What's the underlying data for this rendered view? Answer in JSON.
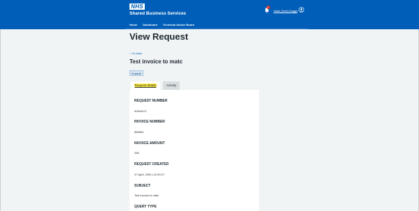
{
  "header": {
    "logo": "NHS",
    "service_name": "Shared Business Services",
    "notification_count": "8",
    "user_name": "Sada (Tech) Dugge",
    "nav": [
      "Home",
      "Dashboard",
      "Technical Advice Board"
    ]
  },
  "page": {
    "title": "View Request",
    "back_link": "Go back",
    "request_title": "Test invoice to matc",
    "status": "In queue"
  },
  "tabs": [
    "Request details",
    "Activity"
  ],
  "details": {
    "request_number_label": "REQUEST NUMBER",
    "request_number": "00944471",
    "invoice_number_label": "INVOICE NUMBER",
    "invoice_number": "856964",
    "invoice_amount_label": "INVOICE AMOUNT",
    "invoice_amount": "256",
    "request_created_label": "REQUEST CREATED",
    "request_created": "07 April, 2026 | 12:50:27",
    "subject_label": "SUBJECT",
    "subject": "Test invoice to matc",
    "query_type_label": "QUERY TYPE"
  },
  "colors": {
    "header_bg": "#005eb8",
    "page_bg": "#f0f4f5",
    "tag_bg": "#d6e4f0",
    "highlight": "#ffeb3b",
    "badge": "#d5281b"
  },
  "icons": [
    "bell-icon",
    "user-icon",
    "chevron-left-icon"
  ]
}
